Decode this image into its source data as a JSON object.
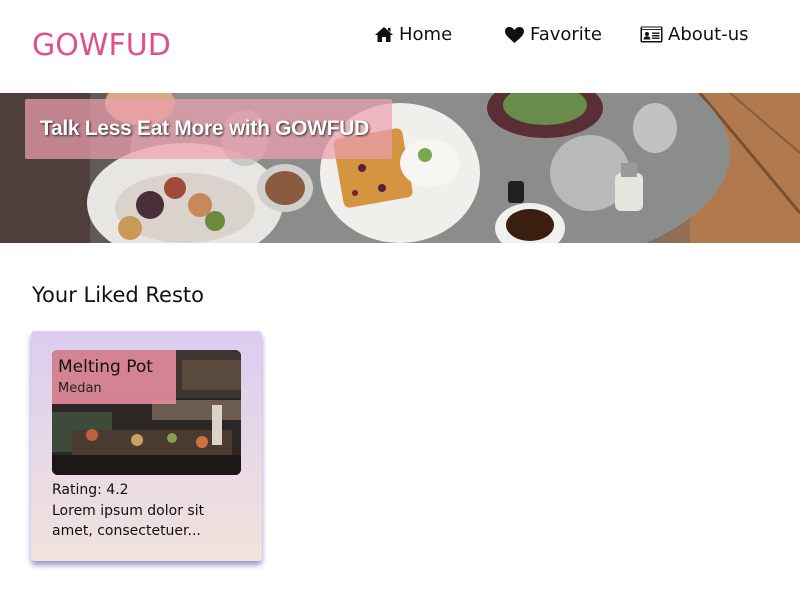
{
  "header": {
    "brand": "GOWFUD",
    "brand_color": "#e0508a",
    "nav": [
      {
        "label": "Home",
        "icon": "home-icon"
      },
      {
        "label": "Favorite",
        "icon": "heart-icon"
      },
      {
        "label": "About-us",
        "icon": "id-card-icon"
      }
    ]
  },
  "hero": {
    "tagline": "Talk Less Eat More with GOWFUD",
    "image": "food-table-photo"
  },
  "main": {
    "section_title": "Your Liked Resto",
    "restaurants": [
      {
        "name": "Melting Pot",
        "city": "Medan",
        "rating_text": "Rating: 4.2",
        "description": "Lorem ipsum dolor sit amet, consectetuer..."
      }
    ]
  },
  "colors": {
    "accent": "#e0508a",
    "banner_overlay": "#eca0af",
    "card_shadow": "#463ca0"
  }
}
